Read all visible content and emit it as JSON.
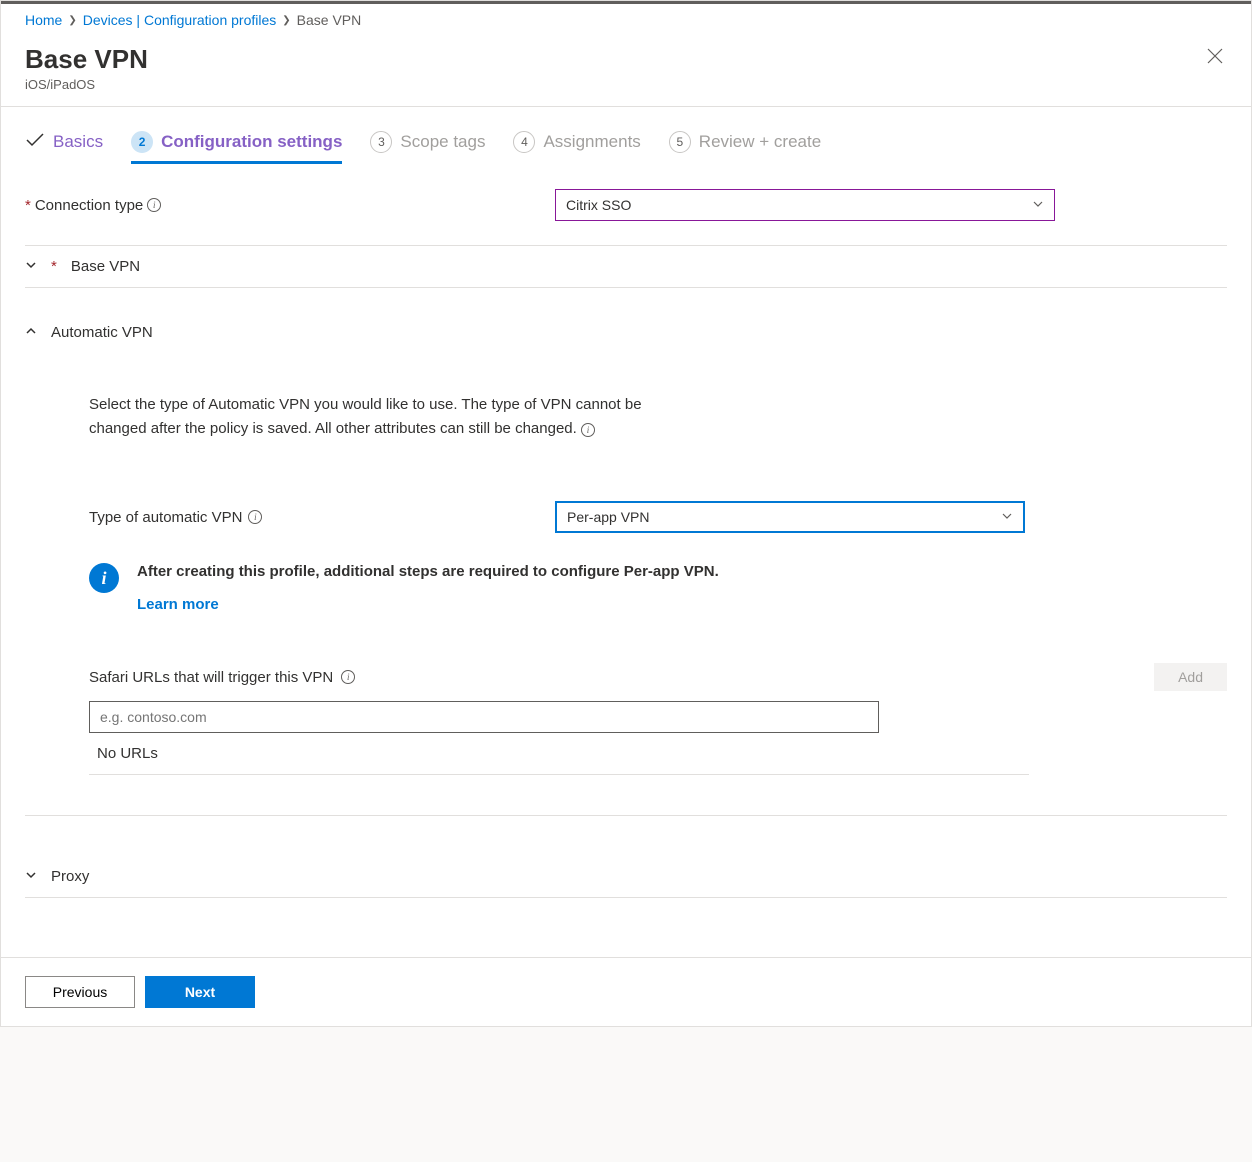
{
  "breadcrumb": {
    "home": "Home",
    "devices": "Devices | Configuration profiles",
    "current": "Base VPN"
  },
  "header": {
    "title": "Base VPN",
    "subtitle": "iOS/iPadOS"
  },
  "tabs": {
    "basics": "Basics",
    "config": "Configuration settings",
    "scope": "Scope tags",
    "assign": "Assignments",
    "review": "Review + create",
    "num2": "2",
    "num3": "3",
    "num4": "4",
    "num5": "5"
  },
  "connection": {
    "label": "Connection type",
    "value": "Citrix SSO"
  },
  "sections": {
    "base_vpn": "Base VPN",
    "auto_vpn": "Automatic VPN",
    "proxy": "Proxy"
  },
  "auto": {
    "description": "Select the type of Automatic VPN you would like to use. The type of VPN cannot be changed after the policy is saved. All other attributes can still be changed.",
    "type_label": "Type of automatic VPN",
    "type_value": "Per-app VPN",
    "info_text": "After creating this profile, additional steps are required to configure Per-app VPN.",
    "learn_more": "Learn more"
  },
  "urls": {
    "label": "Safari URLs that will trigger this VPN",
    "add": "Add",
    "placeholder": "e.g. contoso.com",
    "empty": "No URLs"
  },
  "footer": {
    "previous": "Previous",
    "next": "Next"
  }
}
